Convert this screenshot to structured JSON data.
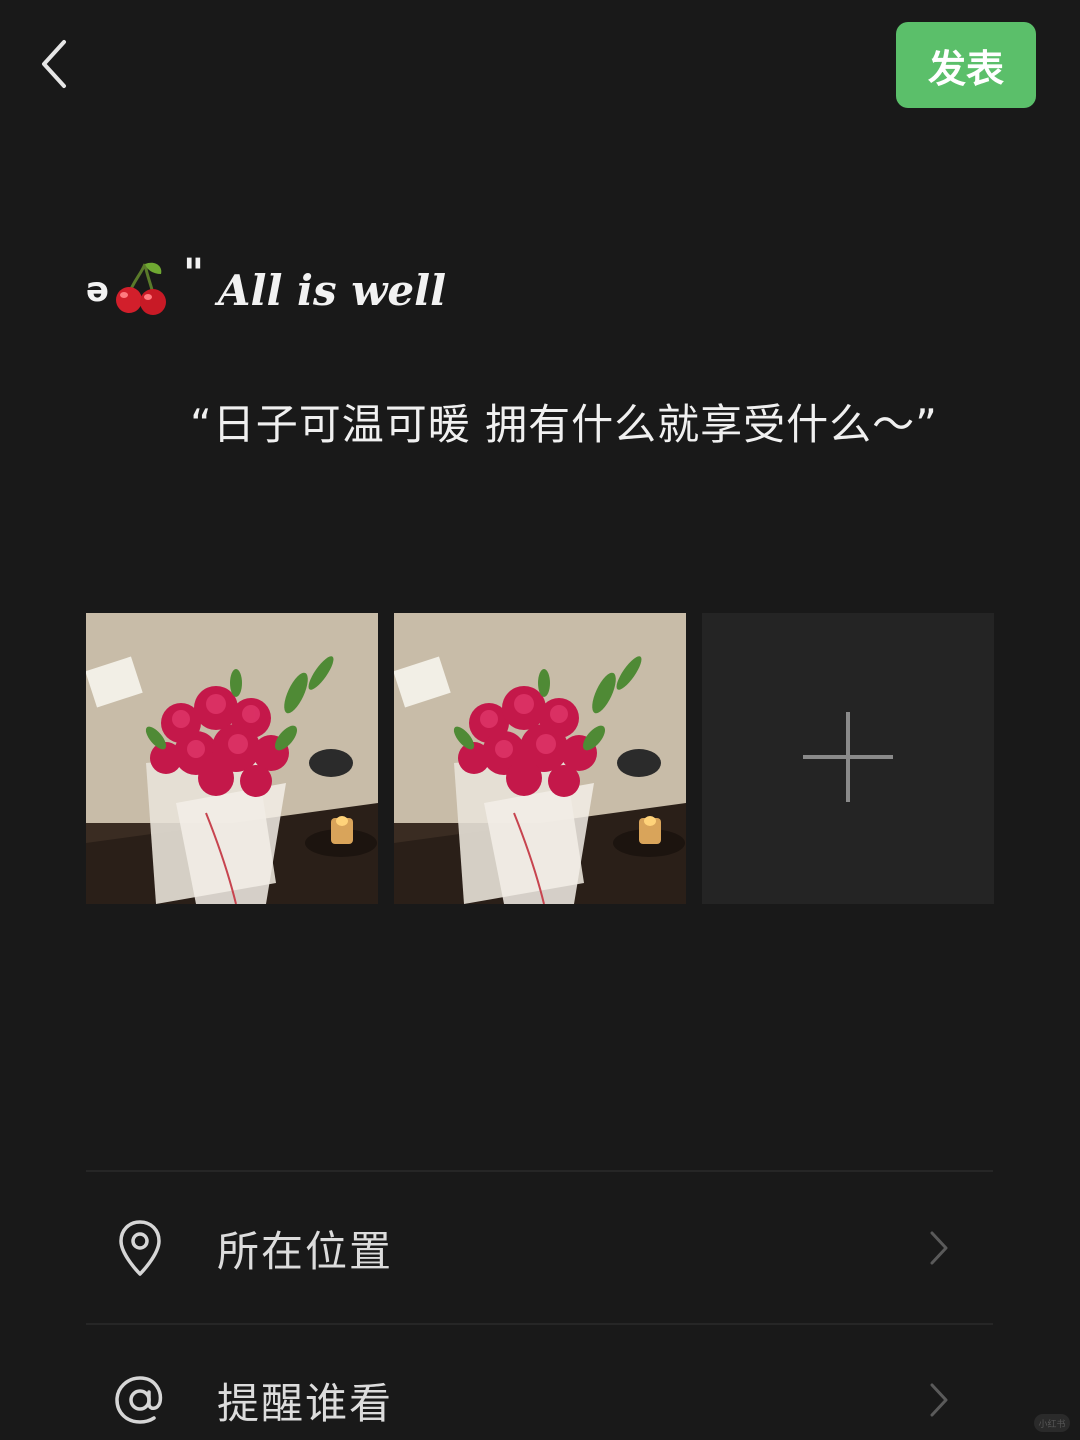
{
  "header": {
    "back_icon": "chevron-left-icon",
    "publish_label": "发表",
    "publish_color": "#5bbf6a"
  },
  "post": {
    "line1_prefix": "ə",
    "cherry_icon": "cherry-emoji",
    "line1_quote": "\"",
    "line1_slogan": "All is well",
    "line2": "“日子可温可暖 拥有什么就享受什么～”"
  },
  "photos": [
    {
      "name": "photo-roses-bouquet-1"
    },
    {
      "name": "photo-roses-bouquet-2"
    }
  ],
  "add_photo_icon": "plus-icon",
  "options": [
    {
      "label": "所在位置",
      "icon": "location-pin-icon"
    },
    {
      "label": "提醒谁看",
      "icon": "at-sign-icon"
    }
  ],
  "watermark": "小红书"
}
